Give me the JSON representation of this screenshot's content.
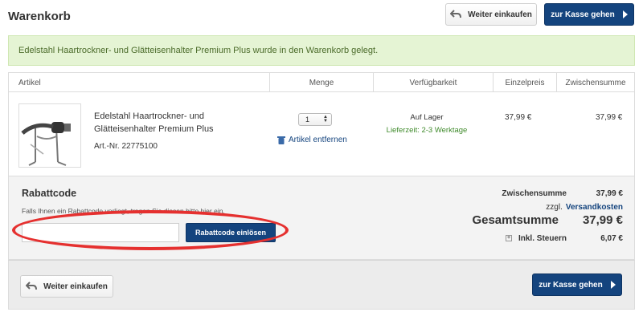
{
  "header": {
    "title": "Warenkorb",
    "continue_label": "Weiter einkaufen",
    "checkout_label": "zur Kasse gehen"
  },
  "notice": {
    "text": "Edelstahl Haartrockner- und Glätteisenhalter Premium Plus wurde in den Warenkorb gelegt."
  },
  "table": {
    "columns": [
      "Artikel",
      "Menge",
      "Verfügbarkeit",
      "Einzelpreis",
      "Zwischensumme"
    ]
  },
  "item": {
    "name": "Edelstahl Haartrockner- und Glätteisenhalter Premium Plus",
    "article_number": "Art.-Nr. 22775100",
    "quantity": "1",
    "remove_label": "Artikel entfernen",
    "availability": "Auf Lager",
    "delivery_time": "Lieferzeit: 2-3 Werktage",
    "unit_price": "37,99 €",
    "subtotal": "37,99 €"
  },
  "coupon": {
    "title": "Rabattcode",
    "hint": "Falls Ihnen ein Rabattcode vorliegt, tragen Sie diesen bitte hier ein.",
    "input_value": "",
    "button_label": "Rabattcode einlösen"
  },
  "summary": {
    "subtotal_label": "Zwischensumme",
    "subtotal_value": "37,99 €",
    "shipping_prefix": "zzgl.",
    "shipping_link": "Versandkosten",
    "total_label": "Gesamtsumme",
    "total_value": "37,99 €",
    "tax_label": "Inkl. Steuern",
    "tax_value": "6,07 €"
  },
  "footer": {
    "continue_label": "Weiter einkaufen",
    "checkout_label": "zur Kasse gehen"
  },
  "colors": {
    "primary": "#14447e",
    "notice_bg": "#e5f4d4",
    "highlight": "#e5302f",
    "in_stock": "#3f8a2b"
  }
}
